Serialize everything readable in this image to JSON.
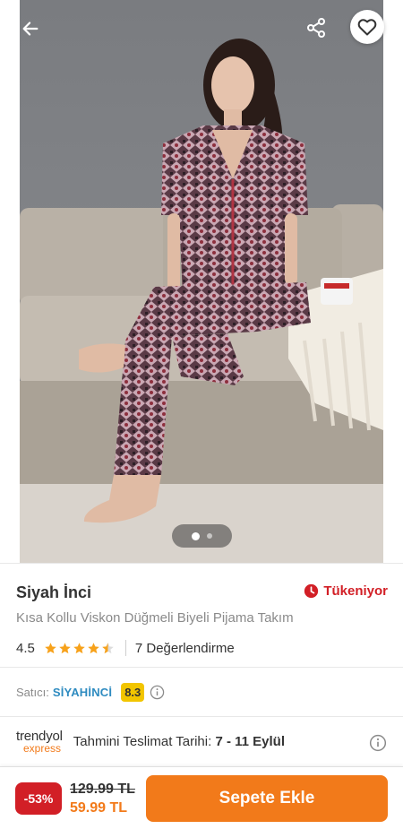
{
  "header": {
    "back_icon": "arrow-left-icon",
    "share_icon": "share-icon",
    "favorite_icon": "heart-outline-icon"
  },
  "gallery": {
    "image_count": 2,
    "active_index": 0
  },
  "product": {
    "brand": "Siyah İnci",
    "stock_status": "Tükeniyor",
    "name": "Kısa Kollu Viskon Düğmeli Biyeli Pijama Takım",
    "rating": "4.5",
    "rating_value": 4.5,
    "review_count": "7 Değerlendirme"
  },
  "seller": {
    "label": "Satıcı:",
    "name": "SİYAHİNCİ",
    "score": "8.3"
  },
  "delivery": {
    "logo_line1": "trendyol",
    "logo_line2": "express",
    "label": "Tahmini Teslimat Tarihi:",
    "dates": "7 - 11 Eylül"
  },
  "pricing": {
    "discount": "-53%",
    "old_price": "129.99 TL",
    "new_price": "59.99 TL",
    "add_to_cart": "Sepete Ekle"
  },
  "colors": {
    "accent_orange": "#f27a1a",
    "discount_red": "#d21f26",
    "seller_blue": "#2e8bc0",
    "score_yellow": "#f2c500",
    "star_orange": "#f7a21b"
  }
}
